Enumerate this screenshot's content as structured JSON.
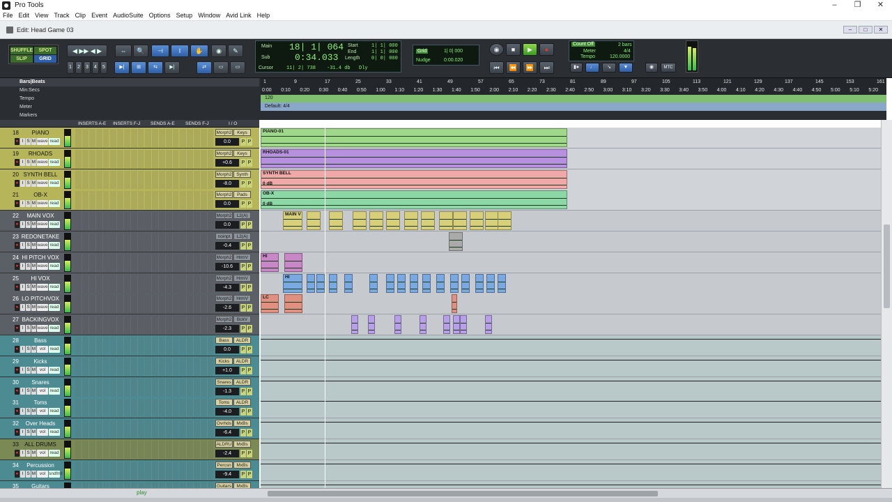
{
  "app": {
    "title": "Pro Tools",
    "window_controls": [
      "–",
      "❐",
      "✕"
    ]
  },
  "menu": [
    "File",
    "Edit",
    "View",
    "Track",
    "Clip",
    "Event",
    "AudioSuite",
    "Options",
    "Setup",
    "Window",
    "Avid Link",
    "Help"
  ],
  "edit_window": {
    "title": "Edit: Head Game 03"
  },
  "toolbar": {
    "modes": [
      "SHUFFLE",
      "SPOT",
      "SLIP",
      "GRID"
    ],
    "zoom_presets": [
      "1",
      "2",
      "3",
      "4",
      "5"
    ],
    "counter": {
      "main_label": "Main",
      "main_value": "18| 1| 064",
      "sub_label": "Sub",
      "sub_value": "0:34.033",
      "start_label": "Start",
      "end_label": "End",
      "length_label": "Length",
      "start_value": "1| 1| 000",
      "end_value": "1| 1| 000",
      "length_value": "0| 0| 000",
      "cursor_label": "Cursor",
      "cursor_value": "11| 2| 738",
      "cursor_db": "-31.4 db",
      "dly": "Dly"
    },
    "grid": {
      "label": "Grid",
      "value": "1| 0| 000",
      "nudge_label": "Nudge",
      "nudge_value": "0:00.020"
    },
    "count_off": {
      "label": "Count Off",
      "value": "2 bars",
      "meter_label": "Meter",
      "meter_value": "4/4",
      "tempo_label": "Tempo",
      "tempo_value": "120.0000"
    },
    "mtc": "MTC"
  },
  "rulers": [
    "Bars|Beats",
    "Min:Secs",
    "Tempo",
    "Meter",
    "Markers"
  ],
  "tempo_marker": "120",
  "meter_marker": "Default: 4/4",
  "bar_ticks": [
    "1",
    "9",
    "17",
    "25",
    "33",
    "41",
    "49",
    "57",
    "65",
    "73",
    "81",
    "89",
    "97",
    "105",
    "113",
    "121",
    "129",
    "137",
    "145",
    "153",
    "161"
  ],
  "time_ticks": [
    "0:00",
    "0:10",
    "0:20",
    "0:30",
    "0:40",
    "0:50",
    "1:00",
    "1:10",
    "1:20",
    "1:30",
    "1:40",
    "1:50",
    "2:00",
    "2:10",
    "2:20",
    "2:30",
    "2:40",
    "2:50",
    "3:00",
    "3:10",
    "3:20",
    "3:30",
    "3:40",
    "3:50",
    "4:00",
    "4:10",
    "4:20",
    "4:30",
    "4:40",
    "4:50",
    "5:00",
    "5:10",
    "5:20"
  ],
  "column_headers": {
    "inserts_ae": "INSERTS A-E",
    "inserts_fj": "INSERTS F-J",
    "sends_ae": "SENDS A-E",
    "sends_fj": "SENDS F-J",
    "io": "I / O"
  },
  "tracks": [
    {
      "num": "18",
      "name": "PIANO",
      "insert": "Morph2",
      "io": "Keys",
      "vol": "0.0",
      "mode": "wave",
      "auto": "read",
      "color": "#b7b55a",
      "clip": "PIANO-01",
      "clipcolor": "#9fd88a"
    },
    {
      "num": "19",
      "name": "RHOADS",
      "insert": "Morph2",
      "io": "Keys",
      "vol": "+0.6",
      "mode": "wave",
      "auto": "read",
      "color": "#b7b55a",
      "clip": "RHOADS-01",
      "clipcolor": "#b890e0"
    },
    {
      "num": "20",
      "name": "SYNTH BELL",
      "insert": "Morph2",
      "io": "Synth",
      "vol": "-8.0",
      "mode": "wave",
      "auto": "read",
      "color": "#b7b55a",
      "clip": "SYNTH BELL",
      "clipcolor": "#f0a8a8",
      "clipvol": "0 dB"
    },
    {
      "num": "21",
      "name": "OB-X",
      "insert": "Morph2",
      "io": "Pads",
      "vol": "0.0",
      "mode": "wave",
      "auto": "read",
      "color": "#b7b55a",
      "clip": "OB-X",
      "clipcolor": "#8ed8a8",
      "clipvol": "0 dB"
    },
    {
      "num": "22",
      "name": "MAIN VOX",
      "insert": "Morph2",
      "io": "L2(A)",
      "vol": "0.0",
      "mode": "wave",
      "auto": "read",
      "color": "#5b6066",
      "clip": "MAIN V",
      "clipcolor": "#d8cf7a"
    },
    {
      "num": "23",
      "name": "REDONETAKE",
      "insert": "noinpt",
      "io": "L2(A)",
      "vol": "-0.4",
      "mode": "wave",
      "auto": "read",
      "color": "#5b6066"
    },
    {
      "num": "24",
      "name": "HI PITCH VOX",
      "insert": "Morph2",
      "io": "HrmV",
      "vol": "-10.6",
      "mode": "wave",
      "auto": "read",
      "color": "#5b6066",
      "clip": "HI",
      "clipcolor": "#c888c8"
    },
    {
      "num": "25",
      "name": "HI VOX",
      "insert": "Morph2",
      "io": "HrmV",
      "vol": "-4.3",
      "mode": "wave",
      "auto": "read",
      "color": "#5b6066",
      "clip": "HI",
      "clipcolor": "#7aa8e0"
    },
    {
      "num": "26",
      "name": "LO PITCHVOX",
      "insert": "Morph2",
      "io": "HrmV",
      "vol": "-2.6",
      "mode": "wave",
      "auto": "read",
      "color": "#5b6066",
      "clip": "LC",
      "clipcolor": "#e09080"
    },
    {
      "num": "27",
      "name": "BACKINGVOX",
      "insert": "Morph2",
      "io": "BckV",
      "vol": "-2.3",
      "mode": "wave",
      "auto": "read",
      "color": "#5b6066",
      "clip": "B",
      "clipcolor": "#b8a0e8"
    },
    {
      "num": "28",
      "name": "Bass",
      "insert": "Bass",
      "io": "ALDR",
      "vol": "0.0",
      "mode": "vol",
      "auto": "read",
      "color": "#4d8b92",
      "pan": "K"
    },
    {
      "num": "29",
      "name": "Kicks",
      "insert": "Kicks",
      "io": "ALDR",
      "vol": "+1.0",
      "mode": "vol",
      "auto": "read",
      "color": "#4d8b92",
      "pan": "S"
    },
    {
      "num": "30",
      "name": "Snares",
      "insert": "Snares",
      "io": "ALDR",
      "vol": "-1.3",
      "mode": "vol",
      "auto": "read",
      "color": "#4d8b92",
      "pan": "T"
    },
    {
      "num": "31",
      "name": "Toms",
      "insert": "Toms",
      "io": "ALDR",
      "vol": "-4.0",
      "mode": "vol",
      "auto": "read",
      "color": "#4d8b92",
      "pan": "O"
    },
    {
      "num": "32",
      "name": "Over Heads",
      "insert": "Ovrhds",
      "io": "MxBs",
      "vol": "-6.4",
      "mode": "vol",
      "auto": "read",
      "color": "#4d8b92",
      "pan": "P"
    },
    {
      "num": "33",
      "name": "ALL DRUMS",
      "insert": "ALDRU",
      "io": "MxBs",
      "vol": "-2.4",
      "mode": "vol",
      "auto": "read",
      "color": "#7b8a54"
    },
    {
      "num": "34",
      "name": "Percussion",
      "insert": "Percsn",
      "io": "MxBs",
      "vol": "-9.4",
      "mode": "vol",
      "auto": "sndfmt",
      "color": "#4d8b92",
      "pan": "G"
    },
    {
      "num": "35",
      "name": "Guitars",
      "insert": "Guitars",
      "io": "MxBs",
      "vol": "",
      "mode": "vol",
      "auto": "read",
      "color": "#4d8b92"
    }
  ],
  "status": {
    "play": "play"
  }
}
